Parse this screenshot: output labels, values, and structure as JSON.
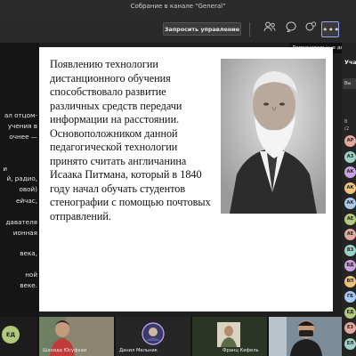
{
  "window": {
    "title": "Собрание в канале \"General\""
  },
  "toolbar": {
    "request_control_label": "Запросить управление",
    "more_tooltip": "Дополнительные действия"
  },
  "chat_fragments": [
    "ал отцом-",
    "учения в",
    "очнее —",
    "и",
    "й, радио,",
    "овой)",
    "ейчас,",
    "давателя",
    "ионная",
    "века,",
    "ной",
    "веке."
  ],
  "slide": {
    "text": "Появлению технологии дистанционного обучения способствовало развитие различных средств передачи информации на расстоянии. Основоположником данной педагогической технологии принято считать англичанина Исаака Питмана, который в 1840 году начал обучать студентов стенографии с помощью почтовых отправлений."
  },
  "participants_panel": {
    "title_fragment": "Уча",
    "field_fragment": "Вы",
    "section_fragment": "В",
    "count_fragment": "(2",
    "avatars": [
      "АР",
      "АЗ",
      "АК",
      "АК",
      "АК",
      "АЕ",
      "АЕ",
      "ВЗ",
      "ВД",
      "ВП",
      "ГБ",
      "ЕД",
      "ЕЗ",
      "ЕЛ"
    ]
  },
  "video_strip": {
    "tiles": [
      {
        "initials": "ЕД",
        "name": ""
      },
      {
        "initials": "",
        "name": "Шахида Юсуфхаи"
      },
      {
        "initials": "",
        "name": "Данил Мельник"
      },
      {
        "initials": "",
        "name": "Франц Кифель"
      },
      {
        "initials": "",
        "name": ""
      }
    ]
  },
  "colors": {
    "accent": "#9aa0ff",
    "avatar_palette": [
      "#e3a79c",
      "#9ad1c6",
      "#c7a2e0",
      "#f0c27a",
      "#a8c8f0",
      "#b2c97a"
    ]
  }
}
